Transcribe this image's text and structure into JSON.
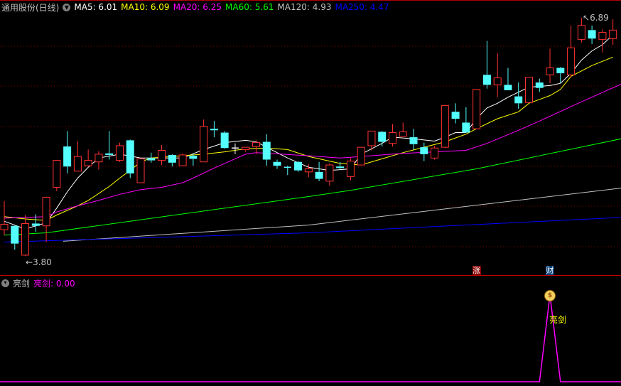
{
  "header": {
    "title": "通用股份(日线)",
    "ma": [
      {
        "label": "MA5: 6.01",
        "color": "#ffffff"
      },
      {
        "label": "MA10: 6.09",
        "color": "#ffff00"
      },
      {
        "label": "MA20: 6.25",
        "color": "#ff00ff"
      },
      {
        "label": "MA60: 5.61",
        "color": "#00ff00"
      },
      {
        "label": "MA120: 4.93",
        "color": "#c0c0c0"
      },
      {
        "label": "MA250: 4.47",
        "color": "#0000ff"
      }
    ]
  },
  "price_labels": {
    "high": "6.89",
    "low": "3.80"
  },
  "event_tags": [
    {
      "text": "涨",
      "index": 45,
      "color": "#8b0000"
    },
    {
      "text": "财",
      "index": 52,
      "color": "#003a70"
    }
  ],
  "indicator": {
    "name": "亮剑",
    "value_label": "亮剑: 0.00",
    "signal_label": "亮剑",
    "signal_icon": "money-bag-icon",
    "signal_index": 52
  },
  "colors": {
    "up": "#ff3232",
    "down": "#54ffff",
    "grid": "#800000",
    "indicator_line": "#ff00ff"
  },
  "chart_data": {
    "type": "candlestick",
    "title": "通用股份(日线)",
    "ylim": [
      3.8,
      6.89
    ],
    "grid": true,
    "ohlc": [
      [
        4.14,
        4.51,
        4.07,
        4.21
      ],
      [
        4.19,
        4.2,
        3.88,
        3.96
      ],
      [
        3.81,
        4.33,
        3.8,
        4.22
      ],
      [
        4.22,
        4.34,
        4.11,
        4.19
      ],
      [
        4.19,
        4.57,
        3.98,
        4.56
      ],
      [
        4.69,
        5.04,
        4.64,
        5.04
      ],
      [
        5.22,
        5.42,
        4.87,
        4.96
      ],
      [
        4.9,
        5.29,
        4.9,
        5.09
      ],
      [
        4.97,
        5.18,
        4.97,
        5.04
      ],
      [
        5.02,
        5.16,
        4.92,
        5.12
      ],
      [
        5.13,
        5.42,
        5.05,
        5.11
      ],
      [
        5.04,
        5.27,
        5.02,
        5.23
      ],
      [
        5.3,
        5.31,
        4.81,
        4.87
      ],
      [
        4.75,
        5.06,
        4.75,
        5.06
      ],
      [
        5.07,
        5.14,
        5.01,
        5.04
      ],
      [
        5.04,
        5.24,
        4.98,
        5.17
      ],
      [
        5.11,
        5.12,
        4.96,
        5.01
      ],
      [
        4.97,
        5.13,
        4.97,
        5.11
      ],
      [
        5.1,
        5.13,
        4.97,
        5.06
      ],
      [
        5.02,
        5.57,
        5.02,
        5.48
      ],
      [
        5.45,
        5.55,
        5.34,
        5.43
      ],
      [
        5.4,
        5.42,
        5.19,
        5.2
      ],
      [
        5.2,
        5.26,
        5.12,
        5.2
      ],
      [
        5.18,
        5.21,
        5.15,
        5.21
      ],
      [
        5.22,
        5.3,
        5.12,
        5.27
      ],
      [
        5.28,
        5.38,
        4.97,
        5.05
      ],
      [
        5.02,
        5.05,
        4.93,
        4.97
      ],
      [
        4.95,
        4.97,
        4.85,
        4.95
      ],
      [
        5.02,
        5.03,
        4.89,
        4.91
      ],
      [
        4.89,
        4.99,
        4.82,
        4.93
      ],
      [
        4.89,
        5.02,
        4.77,
        4.8
      ],
      [
        4.77,
        5.0,
        4.71,
        4.98
      ],
      [
        4.96,
        5.02,
        4.93,
        4.94
      ],
      [
        4.83,
        5.07,
        4.78,
        5.03
      ],
      [
        4.98,
        5.21,
        4.98,
        5.21
      ],
      [
        5.23,
        5.42,
        5.17,
        5.42
      ],
      [
        5.41,
        5.42,
        5.22,
        5.28
      ],
      [
        5.26,
        5.51,
        5.22,
        5.4
      ],
      [
        5.35,
        5.53,
        5.35,
        5.41
      ],
      [
        5.34,
        5.45,
        5.18,
        5.25
      ],
      [
        5.21,
        5.27,
        5.03,
        5.12
      ],
      [
        5.07,
        5.23,
        5.05,
        5.2
      ],
      [
        5.21,
        5.75,
        5.2,
        5.75
      ],
      [
        5.67,
        5.78,
        5.52,
        5.58
      ],
      [
        5.53,
        5.73,
        5.4,
        5.4
      ],
      [
        5.45,
        5.96,
        5.45,
        5.96
      ],
      [
        6.15,
        6.59,
        5.97,
        6.02
      ],
      [
        6.02,
        6.43,
        5.86,
        6.11
      ],
      [
        6.02,
        6.24,
        5.95,
        5.95
      ],
      [
        5.87,
        6.05,
        5.71,
        5.78
      ],
      [
        5.79,
        6.12,
        5.79,
        6.12
      ],
      [
        6.05,
        6.1,
        5.93,
        5.98
      ],
      [
        6.15,
        6.49,
        6.04,
        6.24
      ],
      [
        6.24,
        6.25,
        6.04,
        6.17
      ],
      [
        6.15,
        6.79,
        6.12,
        6.5
      ],
      [
        6.61,
        6.89,
        6.57,
        6.79
      ],
      [
        6.73,
        6.79,
        6.55,
        6.62
      ],
      [
        6.61,
        6.74,
        6.44,
        6.7
      ],
      [
        6.62,
        6.87,
        6.54,
        6.73
      ]
    ],
    "ma_lines": [
      {
        "name": "MA5",
        "color": "#ffffff",
        "points": [
          [
            0,
            4.25
          ],
          [
            2,
            4.15
          ],
          [
            4,
            4.23
          ],
          [
            5,
            4.42
          ],
          [
            6,
            4.63
          ],
          [
            7,
            4.81
          ],
          [
            8,
            4.95
          ],
          [
            9,
            5.07
          ],
          [
            11,
            5.12
          ],
          [
            13,
            5.07
          ],
          [
            17,
            5.07
          ],
          [
            19,
            5.18
          ],
          [
            21,
            5.27
          ],
          [
            23,
            5.3
          ],
          [
            24,
            5.28
          ],
          [
            25,
            5.21
          ],
          [
            27,
            5.07
          ],
          [
            29,
            4.95
          ],
          [
            31,
            4.91
          ],
          [
            33,
            4.93
          ],
          [
            34,
            5.12
          ],
          [
            36,
            5.26
          ],
          [
            37,
            5.34
          ],
          [
            39,
            5.32
          ],
          [
            41,
            5.29
          ],
          [
            42,
            5.34
          ],
          [
            43,
            5.4
          ],
          [
            44,
            5.4
          ],
          [
            45,
            5.58
          ],
          [
            46,
            5.72
          ],
          [
            47,
            5.78
          ],
          [
            48,
            5.86
          ],
          [
            50,
            5.99
          ],
          [
            52,
            6.01
          ],
          [
            53,
            6.04
          ],
          [
            54,
            6.17
          ],
          [
            55,
            6.34
          ],
          [
            56,
            6.46
          ],
          [
            57,
            6.54
          ],
          [
            58,
            6.67
          ]
        ]
      },
      {
        "name": "MA10",
        "color": "#ffff00",
        "points": [
          [
            0,
            4.31
          ],
          [
            2,
            4.28
          ],
          [
            4,
            4.26
          ],
          [
            5,
            4.33
          ],
          [
            7,
            4.45
          ],
          [
            8,
            4.52
          ],
          [
            9,
            4.61
          ],
          [
            10,
            4.7
          ],
          [
            11,
            4.81
          ],
          [
            12,
            4.91
          ],
          [
            13,
            5.02
          ],
          [
            14,
            5.07
          ],
          [
            19,
            5.12
          ],
          [
            21,
            5.15
          ],
          [
            23,
            5.19
          ],
          [
            25,
            5.2
          ],
          [
            27,
            5.18
          ],
          [
            29,
            5.09
          ],
          [
            32,
            5.0
          ],
          [
            34,
            4.98
          ],
          [
            36,
            5.06
          ],
          [
            38,
            5.14
          ],
          [
            40,
            5.21
          ],
          [
            42,
            5.28
          ],
          [
            44,
            5.38
          ],
          [
            45,
            5.45
          ],
          [
            47,
            5.58
          ],
          [
            49,
            5.67
          ],
          [
            50,
            5.78
          ],
          [
            52,
            5.88
          ],
          [
            53,
            5.96
          ],
          [
            54,
            6.13
          ],
          [
            56,
            6.27
          ],
          [
            58,
            6.38
          ]
        ]
      },
      {
        "name": "MA20",
        "color": "#ff00ff",
        "points": [
          [
            0,
            4.29
          ],
          [
            4,
            4.31
          ],
          [
            5,
            4.37
          ],
          [
            7,
            4.45
          ],
          [
            9,
            4.52
          ],
          [
            11,
            4.6
          ],
          [
            13,
            4.66
          ],
          [
            15,
            4.69
          ],
          [
            17,
            4.75
          ],
          [
            18,
            4.81
          ],
          [
            20,
            4.94
          ],
          [
            22,
            5.06
          ],
          [
            23,
            5.12
          ],
          [
            24,
            5.14
          ],
          [
            29,
            5.1
          ],
          [
            32,
            5.07
          ],
          [
            38,
            5.13
          ],
          [
            44,
            5.17
          ],
          [
            46,
            5.26
          ],
          [
            49,
            5.43
          ],
          [
            51,
            5.55
          ],
          [
            55,
            5.8
          ],
          [
            58.8,
            6.03
          ]
        ]
      },
      {
        "name": "MA60",
        "color": "#00ff00",
        "points": [
          [
            0,
            4.07
          ],
          [
            4,
            4.1
          ],
          [
            29,
            4.57
          ],
          [
            33,
            4.65
          ],
          [
            45,
            4.93
          ],
          [
            58.8,
            5.32
          ]
        ]
      },
      {
        "name": "MA120",
        "color": "#c0c0c0",
        "points": [
          [
            5.6,
            3.99
          ],
          [
            29,
            4.2
          ],
          [
            58.8,
            4.68
          ]
        ]
      },
      {
        "name": "MA250",
        "color": "#0000ff",
        "points": [
          [
            0,
            3.98
          ],
          [
            29,
            4.1
          ],
          [
            58.8,
            4.3
          ]
        ]
      }
    ],
    "indicator_values": [
      0,
      0,
      0,
      0,
      0,
      0,
      0,
      0,
      0,
      0,
      0,
      0,
      0,
      0,
      0,
      0,
      0,
      0,
      0,
      0,
      0,
      0,
      0,
      0,
      0,
      0,
      0,
      0,
      0,
      0,
      0,
      0,
      0,
      0,
      0,
      0,
      0,
      0,
      0,
      0,
      0,
      0,
      0,
      0,
      0,
      0,
      0,
      0,
      0,
      0,
      0,
      0,
      1,
      0,
      0,
      0,
      0,
      0,
      0
    ]
  }
}
